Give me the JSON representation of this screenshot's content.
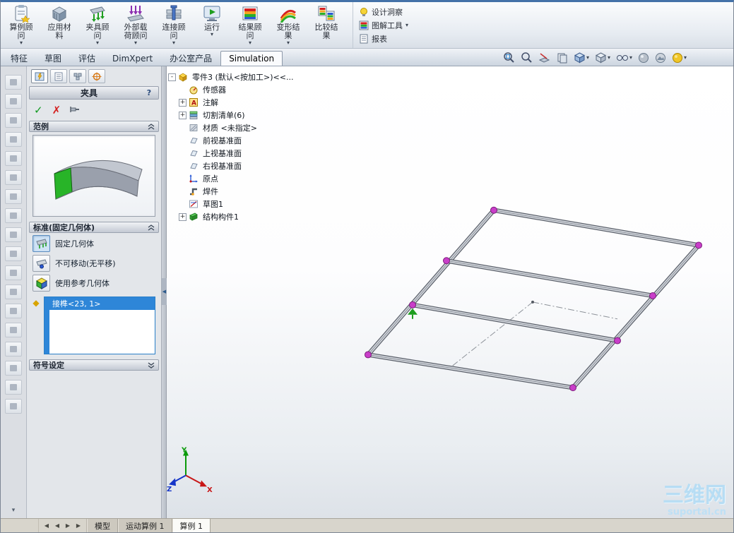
{
  "ribbon": {
    "buttons": [
      {
        "label": "算例顾问",
        "dropdown": "▾"
      },
      {
        "label": "应用材料",
        "dropdown": ""
      },
      {
        "label": "夹具顾问",
        "dropdown": "▾"
      },
      {
        "label": "外部载荷顾问",
        "dropdown": "▾"
      },
      {
        "label": "连接顾问",
        "dropdown": "▾"
      },
      {
        "label": "运行",
        "dropdown": "▾"
      },
      {
        "label": "结果顾问",
        "dropdown": "▾"
      },
      {
        "label": "变形结果",
        "dropdown": "▾"
      },
      {
        "label": "比较结果",
        "dropdown": ""
      }
    ],
    "stack": [
      {
        "label": "设计洞察",
        "dropdown": ""
      },
      {
        "label": "图解工具",
        "dropdown": "▾"
      },
      {
        "label": "报表",
        "dropdown": ""
      }
    ]
  },
  "tabbar": {
    "tabs": [
      {
        "label": "特征"
      },
      {
        "label": "草图"
      },
      {
        "label": "评估"
      },
      {
        "label": "DimXpert"
      },
      {
        "label": "办公室产品"
      },
      {
        "label": "Simulation"
      }
    ],
    "active_tab": "Simulation"
  },
  "panel": {
    "title": "夹具",
    "help": "?",
    "ok": "✓",
    "cancel": "✗",
    "sections": {
      "example_title": "范例",
      "standard_title": "标准(固定几何体)",
      "symbol_title": "符号设定"
    },
    "options": [
      {
        "label": "固定几何体"
      },
      {
        "label": "不可移动(无平移)"
      },
      {
        "label": "使用参考几何体"
      }
    ],
    "selection_items": [
      {
        "label": "接榫<23, 1>"
      }
    ]
  },
  "tree": {
    "items": [
      {
        "label": "零件3 (默认<按加工>)<<...",
        "expander": "-"
      },
      {
        "label": "传感器",
        "expander": ""
      },
      {
        "label": "注解",
        "expander": "+"
      },
      {
        "label": "切割清单(6)",
        "expander": "+"
      },
      {
        "label": "材质 <未指定>",
        "expander": ""
      },
      {
        "label": "前视基准面",
        "expander": ""
      },
      {
        "label": "上视基准面",
        "expander": ""
      },
      {
        "label": "右视基准面",
        "expander": ""
      },
      {
        "label": "原点",
        "expander": ""
      },
      {
        "label": "焊件",
        "expander": ""
      },
      {
        "label": "草图1",
        "expander": ""
      },
      {
        "label": "结构构件1",
        "expander": "+"
      }
    ]
  },
  "viewport": {
    "triad": {
      "x": "X",
      "y": "Y",
      "z": "Z"
    },
    "watermark_line1": "三维网",
    "watermark_line2": "suportal.cn"
  },
  "bottombar": {
    "nav": [
      "◀",
      "◀",
      "▶",
      "▶"
    ],
    "tabs": [
      {
        "label": "模型"
      },
      {
        "label": "运动算例 1"
      },
      {
        "label": "算例 1"
      }
    ],
    "active_tab": "算例 1"
  },
  "glyphs": {
    "dropdown": "▾",
    "splitter": "◀"
  },
  "colors": {
    "selection_blue": "#2e86d8",
    "joint_magenta": "#c93ec9",
    "fixture_green": "#1f9e1f",
    "watermark_blue": "#b7ddf4",
    "check_green": "#0f9a1f",
    "cross_red": "#d42020"
  }
}
